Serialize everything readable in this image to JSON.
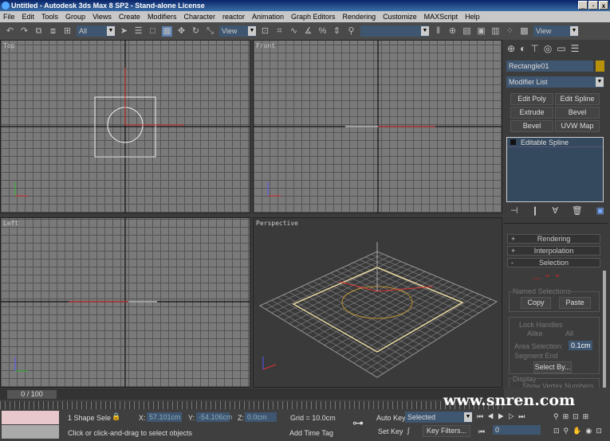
{
  "title": "Untitled - Autodesk 3ds Max 8 SP2  - Stand-alone License",
  "menu": [
    "File",
    "Edit",
    "Tools",
    "Group",
    "Views",
    "Create",
    "Modifiers",
    "Character",
    "reactor",
    "Animation",
    "Graph Editors",
    "Rendering",
    "Customize",
    "MAXScript",
    "Help"
  ],
  "toolbar": {
    "selection_filter": "All",
    "ref_coord": "View",
    "named_sel": "",
    "view2": "View"
  },
  "viewports": {
    "top": "Top",
    "front": "Front",
    "left": "Left",
    "perspective": "Perspective"
  },
  "command_panel": {
    "object_name": "Rectangle01",
    "object_color": "#b8900a",
    "modifier_list": "Modifier List",
    "mod_buttons": [
      "Edit Poly",
      "Edit Spline",
      "Extrude",
      "Bevel",
      "Bevel",
      "UVW Map"
    ],
    "stack": [
      "Editable Spline"
    ],
    "rollouts": [
      {
        "sign": "+",
        "label": "Rendering"
      },
      {
        "sign": "+",
        "label": "Interpolation"
      },
      {
        "sign": "-",
        "label": "Selection"
      }
    ],
    "named_selections": "Named Selections",
    "copy": "Copy",
    "paste": "Paste",
    "lock_handles": "Lock Handles",
    "alike": "Alike",
    "all": "All",
    "area_selection": "Area Selection:",
    "area_value": "0.1cm",
    "segment_end": "Segment End",
    "select_by": "Select By...",
    "display": "Display",
    "show_vertex_numbers": "Show Vertex Numbers"
  },
  "status": {
    "frame": "0 / 100",
    "selection": "1 Shape Sele",
    "x_label": "X:",
    "x": "57.101cm",
    "y_label": "Y:",
    "y": "-54.106cm",
    "z_label": "Z:",
    "z": "0.0cm",
    "grid": "Grid = 10.0cm",
    "prompt": "Click or click-and-drag to select objects",
    "add_time_tag": "Add Time Tag",
    "auto_key": "Auto Key",
    "set_key": "Set Key",
    "key_mode": "Selected",
    "key_filters": "Key Filters...",
    "current_frame": "0"
  },
  "watermark": "www.snren.com"
}
